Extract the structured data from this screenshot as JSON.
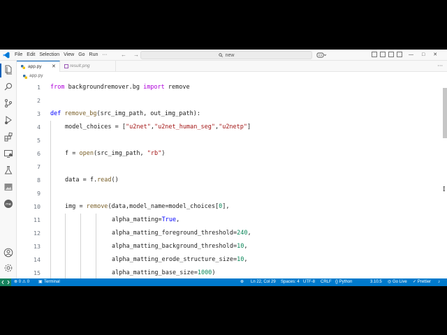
{
  "menu": [
    "File",
    "Edit",
    "Selection",
    "View",
    "Go",
    "Run",
    "···"
  ],
  "nav": {
    "back": "←",
    "forward": "→"
  },
  "search": {
    "text": "new"
  },
  "window_controls": {
    "minimize": "—",
    "maximize": "□",
    "close": "✕"
  },
  "tabs": [
    {
      "label": "app.py",
      "close": "✕"
    },
    {
      "label": "result.png"
    }
  ],
  "tabs_more": "···",
  "breadcrumb": {
    "file": "app.py"
  },
  "editor": {
    "line_numbers": [
      "1",
      "2",
      "3",
      "4",
      "5",
      "6",
      "7",
      "8",
      "9",
      "10",
      "11",
      "12",
      "13",
      "14",
      "15"
    ]
  },
  "status": {
    "errors": "⊗ 0 ⚠ 0",
    "terminal": "Terminal",
    "position": "Ln 22, Col 29",
    "spaces": "Spaces: 4",
    "encoding": "UTF-8",
    "eol": "CRLF",
    "language": "{} Python",
    "version": "3.10.5",
    "golive": "Go Live",
    "prettier": "✓ Prettier",
    "bell": "♪"
  },
  "colors": {
    "accent": "#007acc",
    "remote": "#16825d",
    "keyword": "#0000ff",
    "control": "#af00db",
    "function": "#795e26",
    "string": "#a31515",
    "number": "#098658"
  }
}
